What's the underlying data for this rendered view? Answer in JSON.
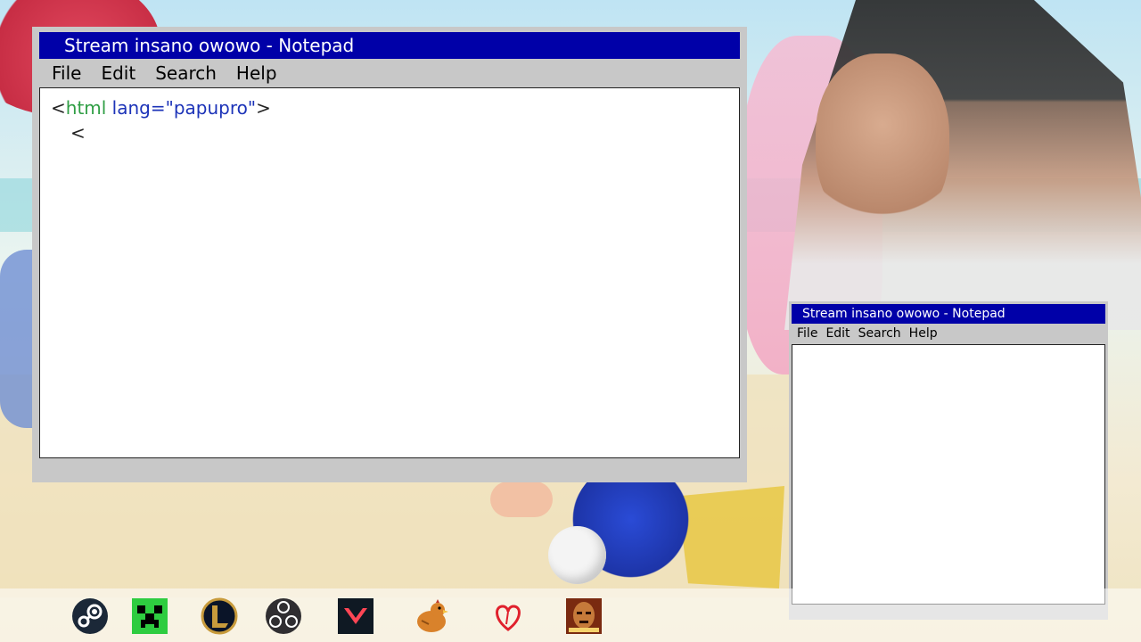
{
  "notepad_main": {
    "title": "Stream insano owowo - Notepad",
    "menu": [
      "File",
      "Edit",
      "Search",
      "Help"
    ],
    "content": {
      "line1": {
        "lt": "<",
        "tag": "html",
        "attr": " lang=\"papupro\"",
        "gt": ">"
      },
      "line2": "<"
    }
  },
  "notepad_small": {
    "title": "Stream insano owowo - Notepad",
    "menu": [
      "File",
      "Edit",
      "Search",
      "Help"
    ]
  },
  "taskbar": {
    "icons": [
      "steam-icon",
      "minecraft-icon",
      "league-of-legends-icon",
      "obs-icon",
      "valorant-icon",
      "chicken-icon",
      "heart-icon",
      "game-portrait-icon"
    ]
  },
  "colors": {
    "titlebar": "#0000a8",
    "window": "#c8c8c8",
    "tag": "#2f9e44",
    "attr": "#1c33b8"
  }
}
